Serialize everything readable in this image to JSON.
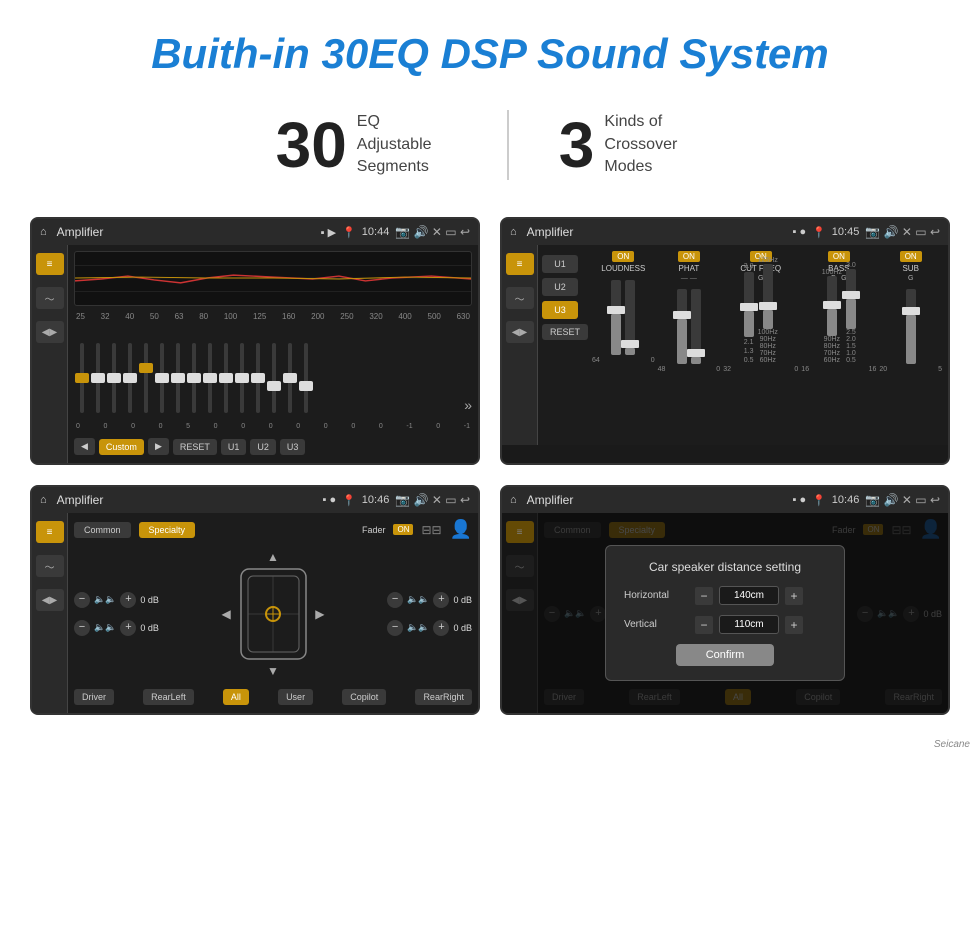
{
  "page": {
    "title": "Buith-in 30EQ DSP Sound System",
    "stat1_number": "30",
    "stat1_desc": "EQ Adjustable\nSegments",
    "stat2_number": "3",
    "stat2_desc": "Kinds of\nCrossover Modes"
  },
  "screen1": {
    "title": "Amplifier",
    "time": "10:44",
    "mode": "Custom",
    "freq_labels": [
      "25",
      "32",
      "40",
      "50",
      "63",
      "80",
      "100",
      "125",
      "160",
      "200",
      "250",
      "320",
      "400",
      "500",
      "630"
    ],
    "slider_values": [
      "0",
      "0",
      "0",
      "0",
      "5",
      "0",
      "0",
      "0",
      "0",
      "0",
      "0",
      "0",
      "-1",
      "0",
      "-1"
    ],
    "presets": [
      "RESET",
      "U1",
      "U2",
      "U3"
    ]
  },
  "screen2": {
    "title": "Amplifier",
    "time": "10:45",
    "presets": [
      "U1",
      "U2",
      "U3"
    ],
    "active_preset": "U3",
    "columns": [
      {
        "label": "LOUDNESS",
        "on": true
      },
      {
        "label": "PHAT",
        "on": true
      },
      {
        "label": "CUT FREQ",
        "on": true
      },
      {
        "label": "BASS",
        "on": true
      },
      {
        "label": "SUB",
        "on": true
      }
    ],
    "reset_label": "RESET"
  },
  "screen3": {
    "title": "Amplifier",
    "time": "10:46",
    "common_label": "Common",
    "specialty_label": "Specialty",
    "fader_label": "Fader",
    "on_label": "ON",
    "db_values": [
      "0 dB",
      "0 dB",
      "0 dB",
      "0 dB"
    ],
    "positions": [
      "Driver",
      "RearLeft",
      "All",
      "Copilot",
      "RearRight",
      "User"
    ]
  },
  "screen4": {
    "title": "Amplifier",
    "time": "10:46",
    "common_label": "Common",
    "specialty_label": "Specialty",
    "on_label": "ON",
    "dialog": {
      "title": "Car speaker distance setting",
      "horizontal_label": "Horizontal",
      "horizontal_value": "140cm",
      "vertical_label": "Vertical",
      "vertical_value": "110cm",
      "confirm_label": "Confirm"
    },
    "db_values": [
      "0 dB",
      "0 dB"
    ],
    "positions": [
      "Driver",
      "RearLeft",
      "All",
      "Copilot",
      "RearRight",
      "User"
    ]
  },
  "watermark": "Seicane"
}
